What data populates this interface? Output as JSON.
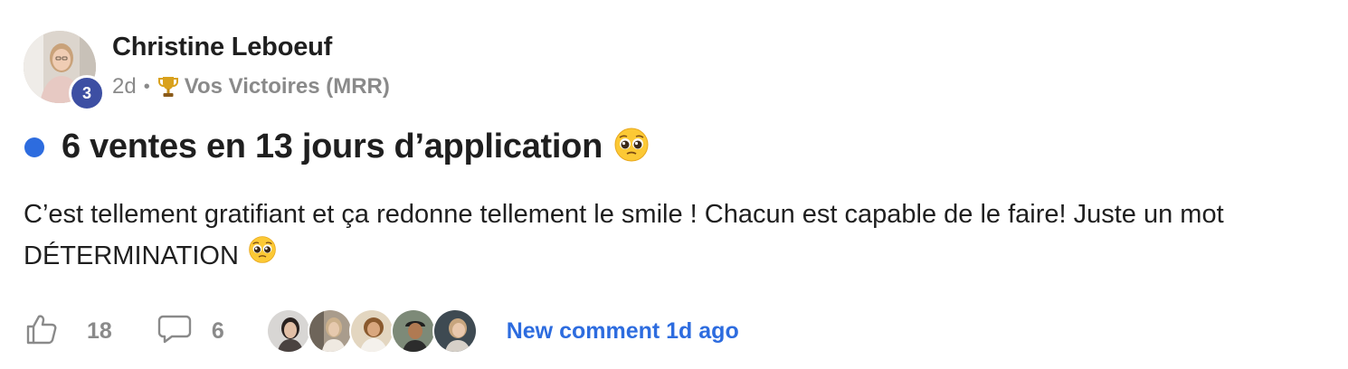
{
  "post": {
    "author": {
      "name": "Christine Leboeuf",
      "level": "3"
    },
    "meta": {
      "time": "2d",
      "separator": "•",
      "category_icon": "trophy-icon",
      "category": "Vos Victoires (MRR)"
    },
    "unread": true,
    "title": "6 ventes en 13 jours d’application",
    "title_emoji": "pleading-face-emoji",
    "body": {
      "line1": "C’est tellement gratifiant et ça redonne tellement le smile ! Chacun est capable de le faire! Juste un mot",
      "line2": "DÉTERMINATION",
      "line2_emoji": "pleading-face-emoji"
    },
    "footer": {
      "likes": "18",
      "comments": "6",
      "commenter_count": 5,
      "new_comment_label": "New comment 1d ago"
    }
  },
  "colors": {
    "accent_blue": "#2d6cdf",
    "level_badge": "#3d4fa3",
    "muted_text": "#8a8a8a",
    "primary_text": "#1f1f1f"
  }
}
